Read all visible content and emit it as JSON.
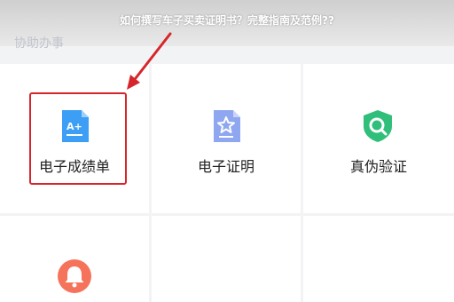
{
  "header": {
    "title": "如何撰写车子买卖证明书？完整指南及范例??"
  },
  "section": {
    "label": "协助办事"
  },
  "services": [
    {
      "label": "电子成绩单",
      "icon": "transcript-document-icon"
    },
    {
      "label": "电子证明",
      "icon": "certificate-document-icon"
    },
    {
      "label": "真伪验证",
      "icon": "shield-search-icon"
    },
    {
      "label": "",
      "icon": "bell-icon"
    }
  ],
  "colors": {
    "highlight": "#d6262b",
    "transcript_icon": "#3c9ef5",
    "certificate_icon": "#8fa6f0",
    "verify_icon": "#2fbf7a",
    "bell_icon": "#f5735a"
  }
}
